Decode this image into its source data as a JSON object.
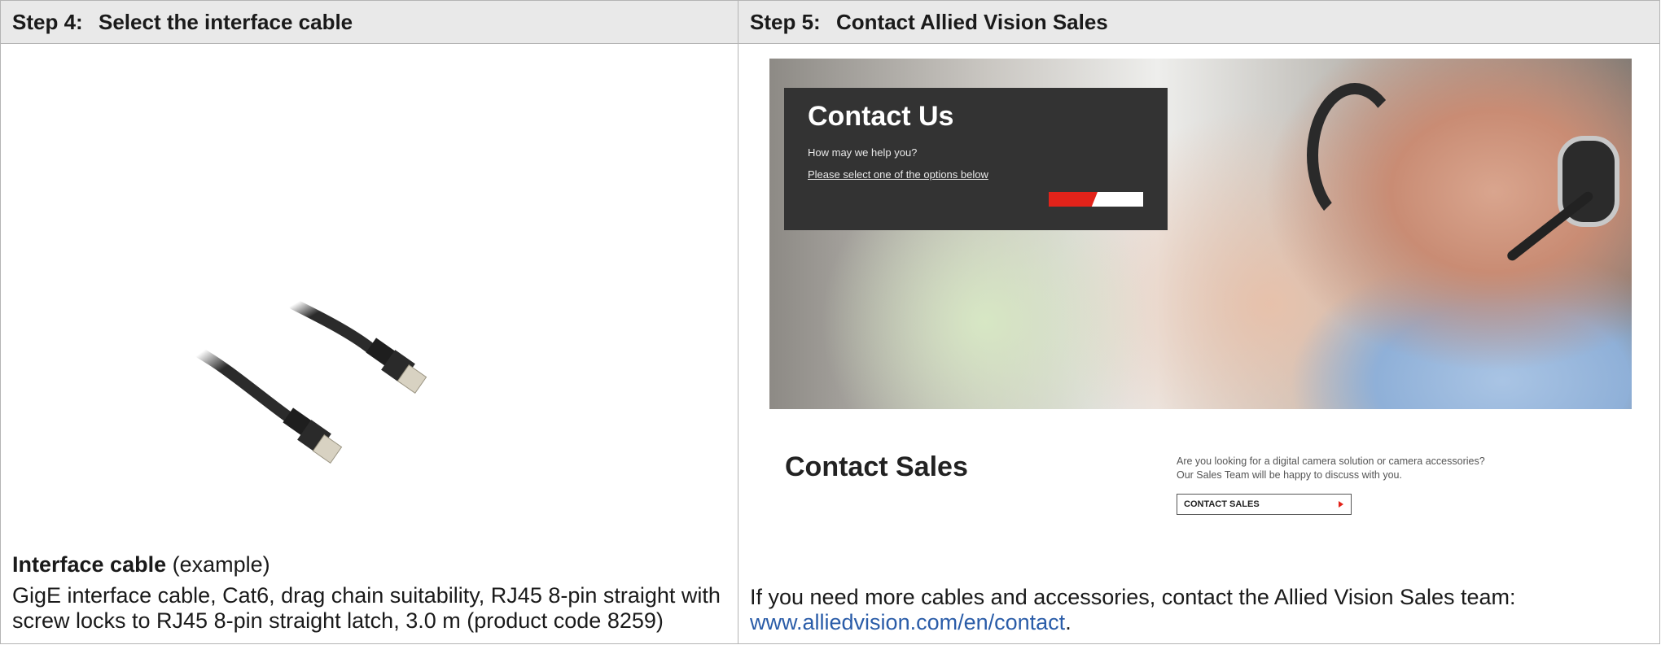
{
  "step4": {
    "number": "Step 4:",
    "title": "Select the interface cable",
    "caption_bold": "Interface cable",
    "caption_rest": " (example)",
    "description": "GigE interface cable, Cat6, drag chain suitability, RJ45 8-pin straight with screw locks to RJ45 8-pin straight latch, 3.0 m (product code 8259)"
  },
  "step5": {
    "number": "Step 5:",
    "title": "Contact Allied Vision Sales",
    "contact_us": {
      "title": "Contact Us",
      "subtitle": "How may we help you?",
      "link": "Please select one of the options below"
    },
    "contact_sales": {
      "title": "Contact Sales",
      "text_line1": "Are you looking for a digital camera solution or camera accessories?",
      "text_line2": "Our Sales Team will be happy to discuss with you.",
      "button": "CONTACT SALES"
    },
    "note_text": "If you need more cables and accessories, contact the Allied Vision Sales team:",
    "note_link": "www.alliedvision.com/en/contact",
    "note_end": "."
  },
  "colors": {
    "accent_red": "#e2231a",
    "link_blue": "#2a5ca8",
    "header_gray": "#e9e9e9"
  }
}
